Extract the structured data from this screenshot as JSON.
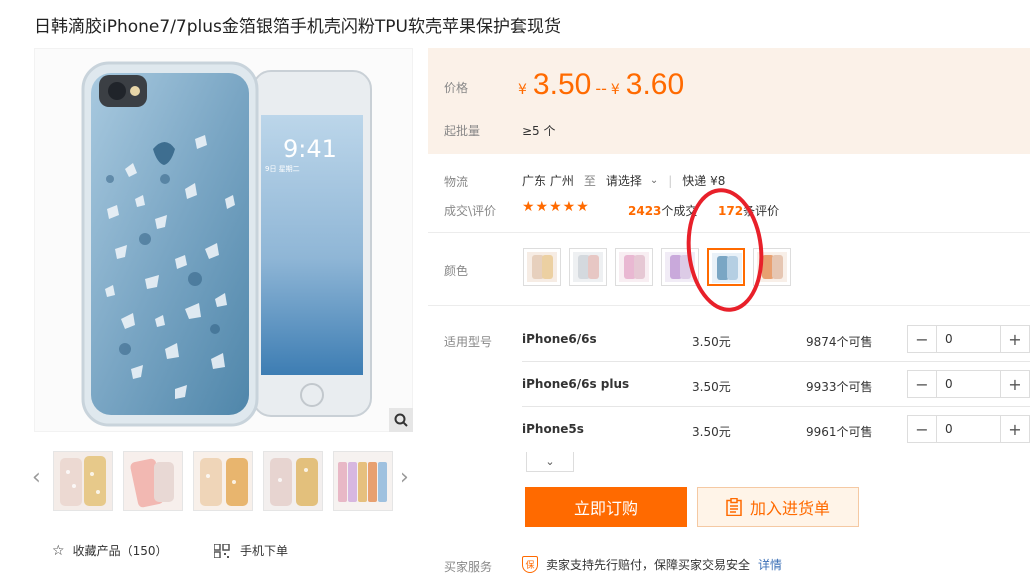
{
  "title": "日韩滴胶iPhone7/7plus金箔银箔手机壳闪粉TPU软壳苹果保护套现货",
  "price": {
    "label": "价格",
    "currency": "¥",
    "low": "3.50",
    "separator": "--",
    "high": "3.60"
  },
  "moq": {
    "label": "起批量",
    "value": "≥5 个"
  },
  "logistics": {
    "label": "物流",
    "from": "广东 广州",
    "to_word": "至",
    "destination": "请选择",
    "express": "快递 ¥8"
  },
  "deals": {
    "label": "成交\\评价",
    "stars": "★★★★★",
    "deal_count": "2423",
    "deal_unit": "个成交",
    "review_count": "172",
    "review_unit": "条评价"
  },
  "color": {
    "label": "颜色",
    "swatches": [
      "gold",
      "silver",
      "pink",
      "purple",
      "blue",
      "orange"
    ],
    "selected_index": 4
  },
  "models": {
    "label": "适用型号",
    "rows": [
      {
        "name": "iPhone6/6s",
        "price": "3.50元",
        "stock": "9874个可售",
        "qty": "0"
      },
      {
        "name": "iPhone6/6s plus",
        "price": "3.50元",
        "stock": "9933个可售",
        "qty": "0"
      },
      {
        "name": "iPhone5s",
        "price": "3.50元",
        "stock": "9961个可售",
        "qty": "0"
      }
    ]
  },
  "actions": {
    "buy": "立即订购",
    "cart": "加入进货单"
  },
  "service": {
    "label": "买家服务",
    "badge": "保",
    "text": "卖家支持先行赔付，保障买家交易安全",
    "link": "详情"
  },
  "favorite": {
    "label": "收藏产品（150）"
  },
  "mobile_order": {
    "label": "手机下单"
  },
  "phone_screen": {
    "time": "9:41",
    "date": "9日 星期二"
  },
  "colors": {
    "accent": "#ff6a00",
    "price_bg": "#fbf1e8",
    "annotation": "#e8202a"
  }
}
